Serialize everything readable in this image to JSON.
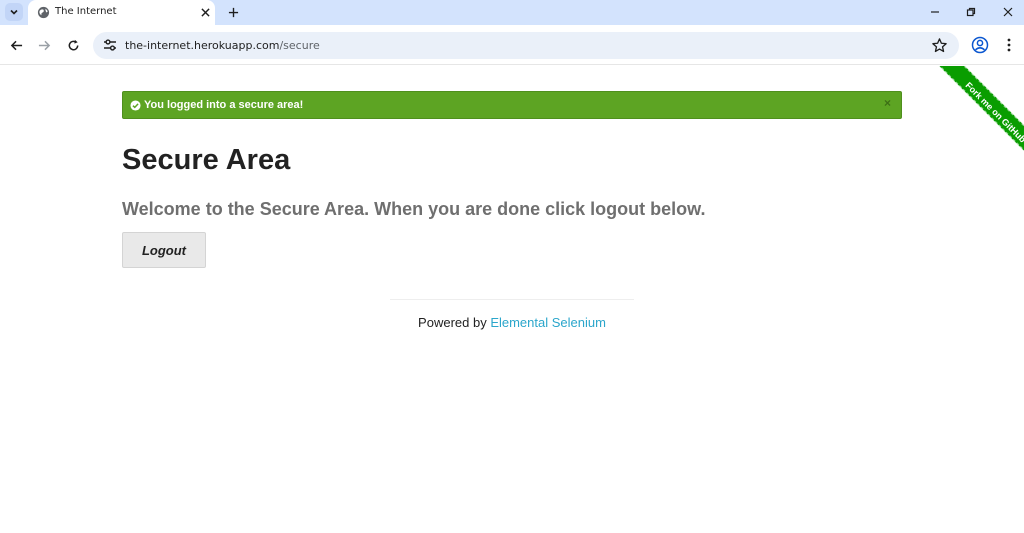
{
  "browser": {
    "tab": {
      "title": "The Internet"
    },
    "address": {
      "domain": "the-internet.herokuapp.com",
      "path": "/secure"
    }
  },
  "page": {
    "flash": {
      "message": "You logged into a secure area!",
      "close": "×"
    },
    "heading": "Secure Area",
    "subheading": "Welcome to the Secure Area. When you are done click logout below.",
    "logout_label": "Logout",
    "footer": {
      "prefix": "Powered by ",
      "link_text": "Elemental Selenium"
    },
    "ribbon_text": "Fork me on GitHub"
  },
  "colors": {
    "flash_bg": "#5da423",
    "link": "#2ba6cb",
    "ribbon": "#099d00",
    "chrome_bg": "#d3e3fd"
  }
}
